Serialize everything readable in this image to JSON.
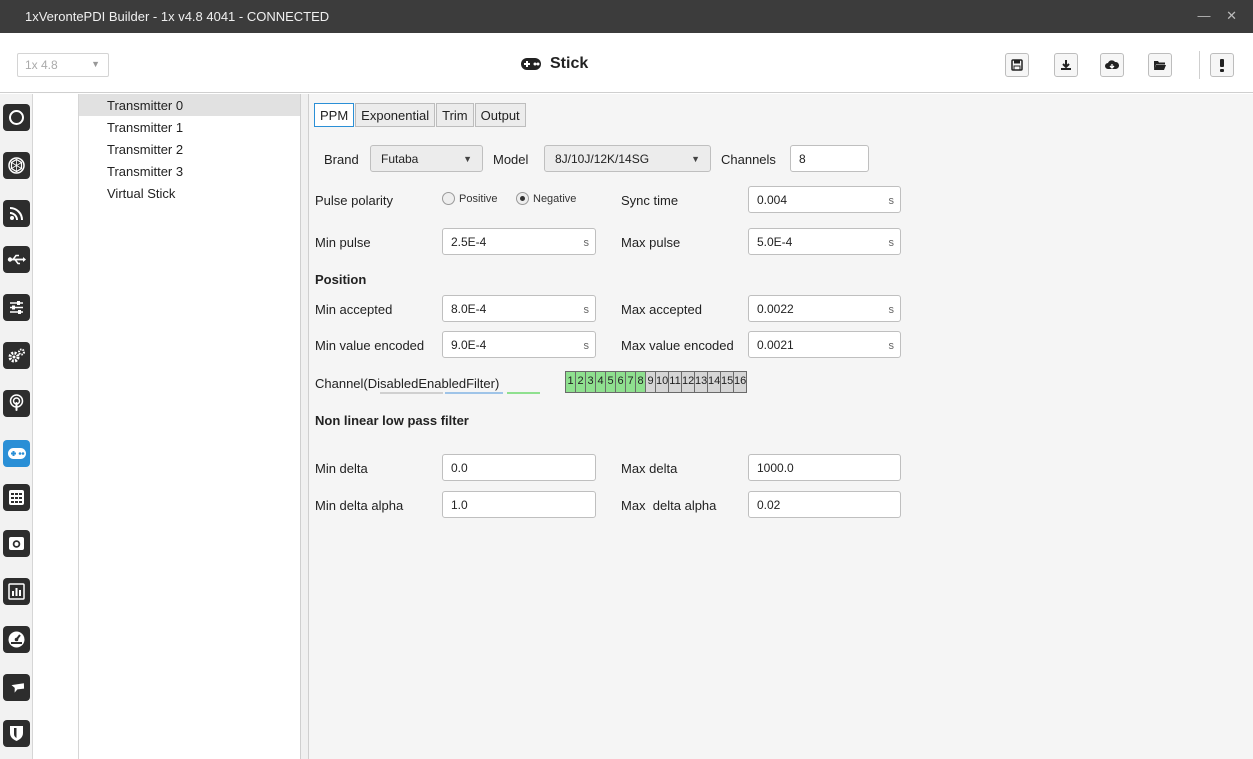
{
  "window": {
    "title": "1xVerontePDI Builder - 1x v4.8 4041 - CONNECTED",
    "controls": "— ✕"
  },
  "header": {
    "version": "1x 4.8",
    "page_title": "Stick"
  },
  "transmitters": [
    "Transmitter 0",
    "Transmitter 1",
    "Transmitter 2",
    "Transmitter 3",
    "Virtual Stick"
  ],
  "tabs": [
    "PPM",
    "Exponential",
    "Trim",
    "Output"
  ],
  "form": {
    "brand_label": "Brand",
    "brand_value": "Futaba",
    "model_label": "Model",
    "model_value": "8J/10J/12K/14SG",
    "channels_label": "Channels",
    "channels_value": "8",
    "pulse_polarity_label": "Pulse polarity",
    "positive_label": "Positive",
    "negative_label": "Negative",
    "sync_time_label": "Sync time",
    "sync_time_value": "0.004",
    "min_pulse_label": "Min pulse",
    "min_pulse_value": "2.5E-4",
    "max_pulse_label": "Max pulse",
    "max_pulse_value": "5.0E-4",
    "unit": "s",
    "position_heading": "Position",
    "min_accepted_label": "Min accepted",
    "min_accepted_value": "8.0E-4",
    "max_accepted_label": "Max accepted",
    "max_accepted_value": "0.0022",
    "min_value_encoded_label": "Min value encoded",
    "min_value_encoded_value": "9.0E-4",
    "max_value_encoded_label": "Max value encoded",
    "max_value_encoded_value": "0.0021",
    "channel_legend": {
      "prefix": "Channel(",
      "disabled": "Disabled",
      "enabled": "Enabled",
      "filter": "Filter",
      "suffix": ")"
    },
    "filter_heading": "Non linear low pass filter",
    "min_delta_label": "Min delta",
    "min_delta_value": "0.0",
    "max_delta_label": "Max delta",
    "max_delta_value": "1000.0",
    "min_delta_alpha_label": "Min delta alpha",
    "min_delta_alpha_value": "1.0",
    "max_delta_alpha_label": "Max  delta alpha",
    "max_delta_alpha_value": "0.02"
  },
  "channel_numbers": [
    "1",
    "2",
    "3",
    "4",
    "5",
    "6",
    "7",
    "8",
    "9",
    "10",
    "11",
    "12",
    "13",
    "14",
    "15",
    "16"
  ],
  "channel_enabled_count": 8,
  "colors": {
    "accent": "#2a8fd6",
    "enabled": "#8fe08f",
    "disabled": "#d6d6d6"
  },
  "sidebar_icons": [
    "power-icon",
    "hexagon-icon",
    "rss-icon",
    "usb-icon",
    "sliders-icon",
    "gears-icon",
    "broadcast-icon",
    "gamepad-icon",
    "keypad-icon",
    "camera-icon",
    "chart-icon",
    "gauge-icon",
    "plane-icon",
    "shield-icon"
  ],
  "toolbar_icons": [
    "save-icon",
    "download-icon",
    "cloud-icon",
    "folder-icon",
    "alert-icon"
  ]
}
